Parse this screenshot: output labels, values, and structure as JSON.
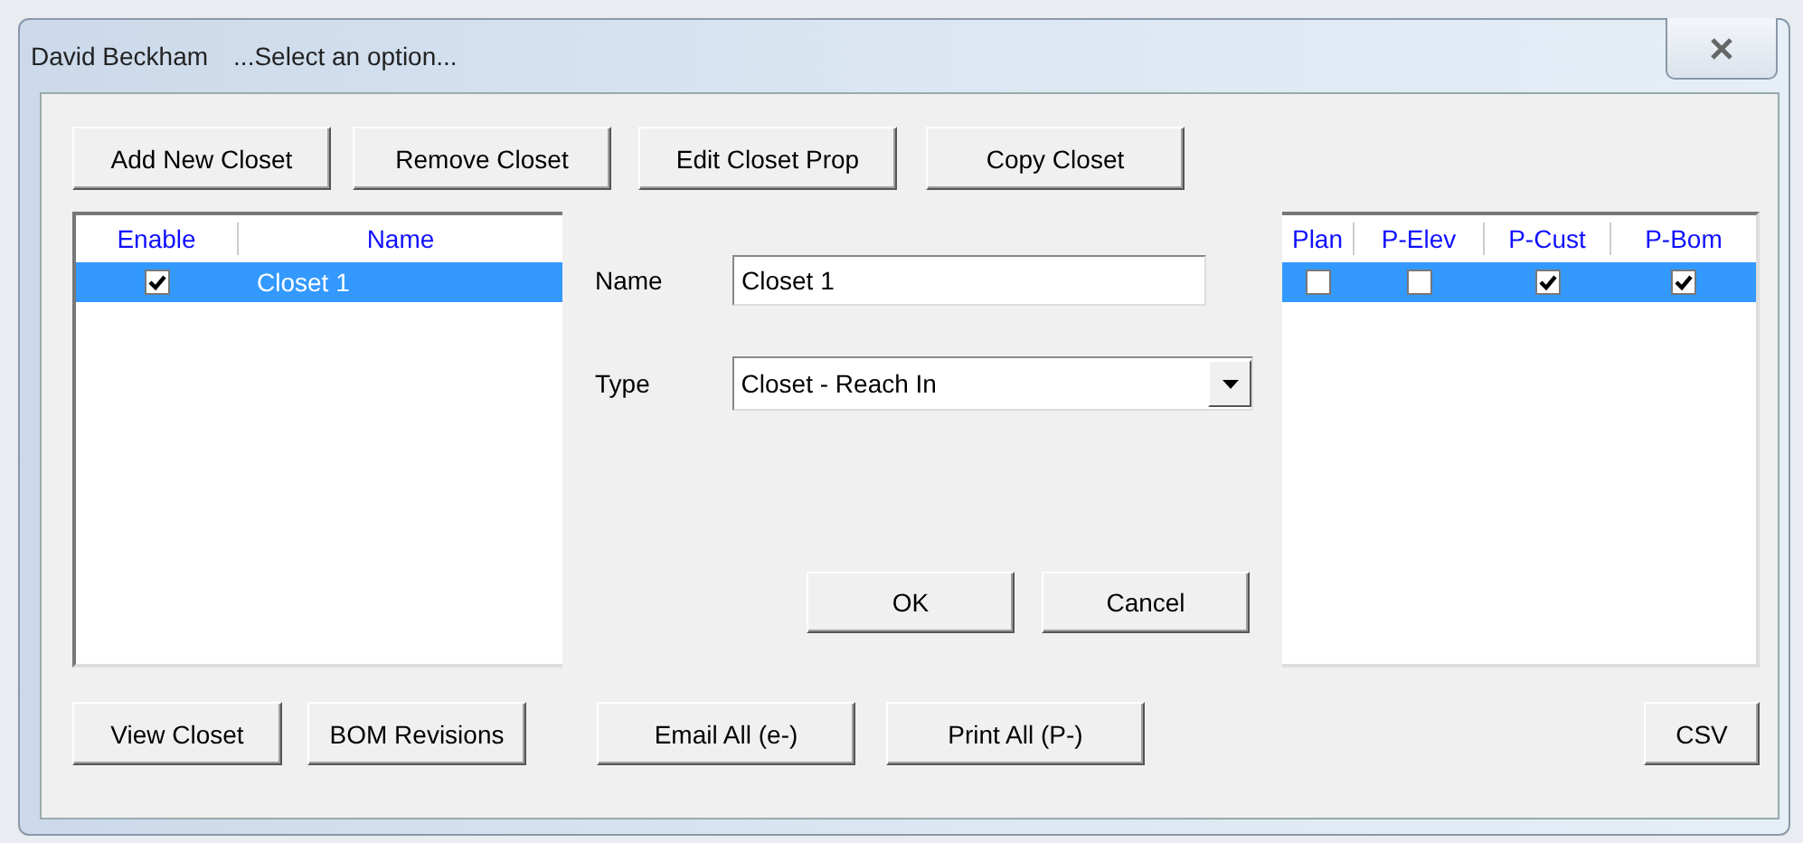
{
  "window": {
    "title": "David Beckham",
    "subtitle": "...Select an option..."
  },
  "toolbar": [
    "Add New Closet",
    "Remove Closet",
    "Edit Closet Prop",
    "Copy Closet"
  ],
  "table": {
    "columns": [
      "Enable",
      "Name",
      "Plan",
      "P-Elev",
      "P-Cust",
      "P-Bom"
    ],
    "rows": [
      {
        "selected": true,
        "cells": [
          {
            "kind": "checkbox",
            "checked": true
          },
          {
            "kind": "text",
            "text": "Closet 1"
          },
          {
            "kind": "checkbox",
            "checked": false
          },
          {
            "kind": "checkbox",
            "checked": false
          },
          {
            "kind": "checkbox",
            "checked": true
          },
          {
            "kind": "checkbox",
            "checked": true
          }
        ]
      }
    ]
  },
  "dialog": {
    "name": {
      "label": "Name",
      "value": "Closet 1"
    },
    "type": {
      "label": "Type",
      "value": "Closet - Reach In"
    },
    "buttons": [
      "OK",
      "Cancel"
    ]
  },
  "bottom_buttons": [
    "View Closet",
    "BOM Revisions",
    "Email All (e-)",
    "Print All (P-)",
    "CSV"
  ]
}
